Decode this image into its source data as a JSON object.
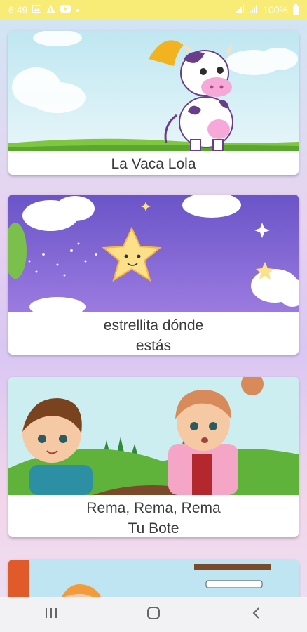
{
  "status_bar": {
    "time": "6:49",
    "battery_percent": "100%",
    "left_icons": [
      "gallery-icon",
      "alert-icon",
      "youtube-icon",
      "dot-icon"
    ],
    "right_icons": [
      "signal-icon",
      "signal-icon",
      "battery-icon"
    ]
  },
  "songs": [
    {
      "title_lines": [
        "La Vaca Lola"
      ],
      "art": "purple-cow-with-umbrella-on-meadow"
    },
    {
      "title_lines": [
        "estrellita dónde",
        "estás"
      ],
      "art": "smiling-star-on-purple-sky"
    },
    {
      "title_lines": [
        "Rema, Rema, Rema",
        "Tu Bote"
      ],
      "art": "two-kids-in-green-hills"
    }
  ],
  "colors": {
    "status_bar": "#f8ec77",
    "card_text": "#3a3a3a"
  },
  "nav_bar": {
    "buttons": [
      "recent-apps-icon",
      "home-icon",
      "back-icon"
    ]
  }
}
